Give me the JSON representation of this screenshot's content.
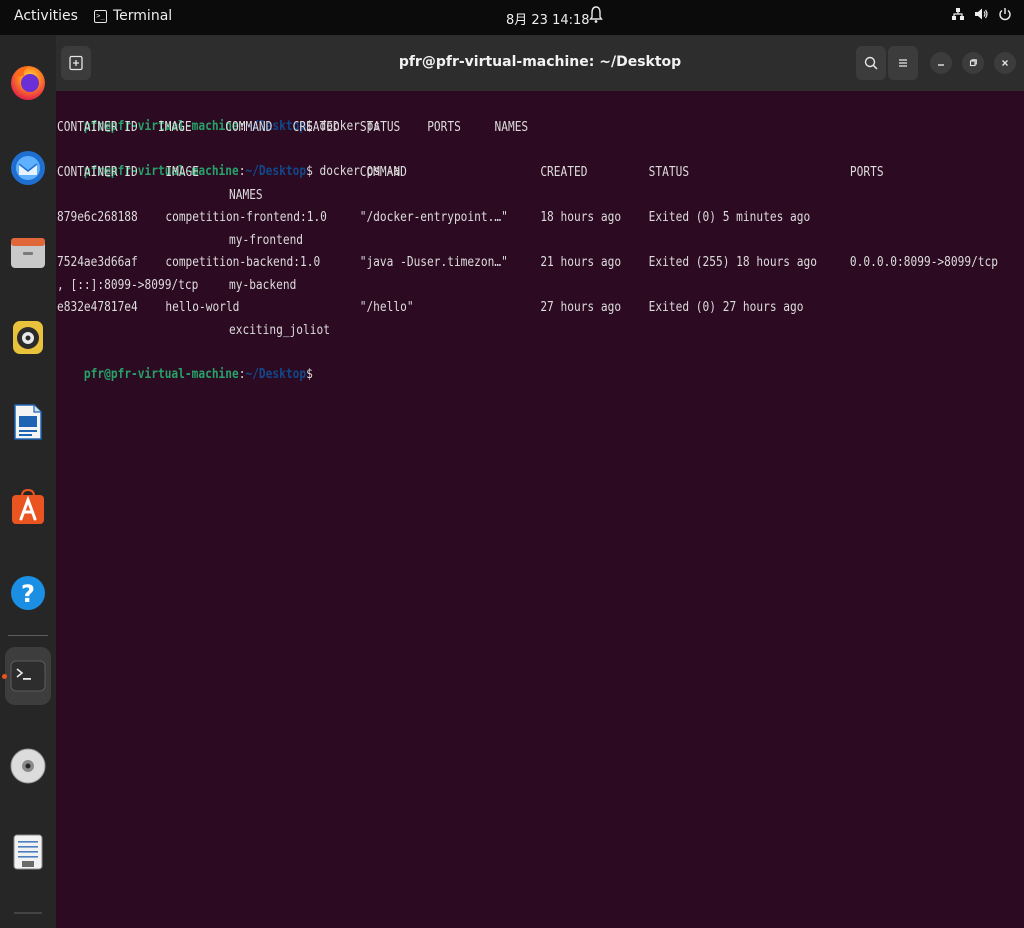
{
  "topbar": {
    "activities": "Activities",
    "app_name": "Terminal",
    "clock": "8月 23  14:18"
  },
  "dock": {
    "items": [
      {
        "name": "Firefox"
      },
      {
        "name": "Thunderbird Mail"
      },
      {
        "name": "Files"
      },
      {
        "name": "Rhythmbox"
      },
      {
        "name": "LibreOffice Writer"
      },
      {
        "name": "Ubuntu Software"
      },
      {
        "name": "Help"
      },
      {
        "name": "Terminal"
      },
      {
        "name": "Disc"
      },
      {
        "name": "Text Editor"
      }
    ]
  },
  "window": {
    "title": "pfr@pfr-virtual-machine: ~/Desktop"
  },
  "terminal": {
    "prompt_user": "pfr@pfr-virtual-machine",
    "prompt_colon": ":",
    "prompt_path": "~/Desktop",
    "prompt_dollar": "$",
    "cmd1": " docker ps",
    "ps_header": "CONTAINER ID   IMAGE     COMMAND   CREATED   STATUS    PORTS     NAMES",
    "cmd2": " docker ps -a",
    "headers": {
      "container_id": "CONTAINER ID",
      "image": "IMAGE",
      "command": "COMMAND",
      "created": "CREATED",
      "status": "STATUS",
      "ports": "PORTS",
      "names": "NAMES"
    },
    "rows": [
      {
        "container_id": "879e6c268188",
        "image": "competition-frontend:1.0",
        "command": "\"/docker-entrypoint.…\"",
        "created": "18 hours ago",
        "status": "Exited (0) 5 minutes ago",
        "ports": "",
        "ports_cont": "",
        "names": "my-frontend"
      },
      {
        "container_id": "7524ae3d66af",
        "image": "competition-backend:1.0",
        "command": "\"java -Duser.timezon…\"",
        "created": "21 hours ago",
        "status": "Exited (255) 18 hours ago",
        "ports": "0.0.0.0:8099->8099/tcp",
        "ports_cont": ", [::]:8099->8099/tcp",
        "names": "my-backend"
      },
      {
        "container_id": "e832e47817e4",
        "image": "hello-world",
        "command": "\"/hello\"",
        "created": "27 hours ago",
        "status": "Exited (0) 27 hours ago",
        "ports": "",
        "ports_cont": "",
        "names": "exciting_joliot"
      }
    ]
  }
}
